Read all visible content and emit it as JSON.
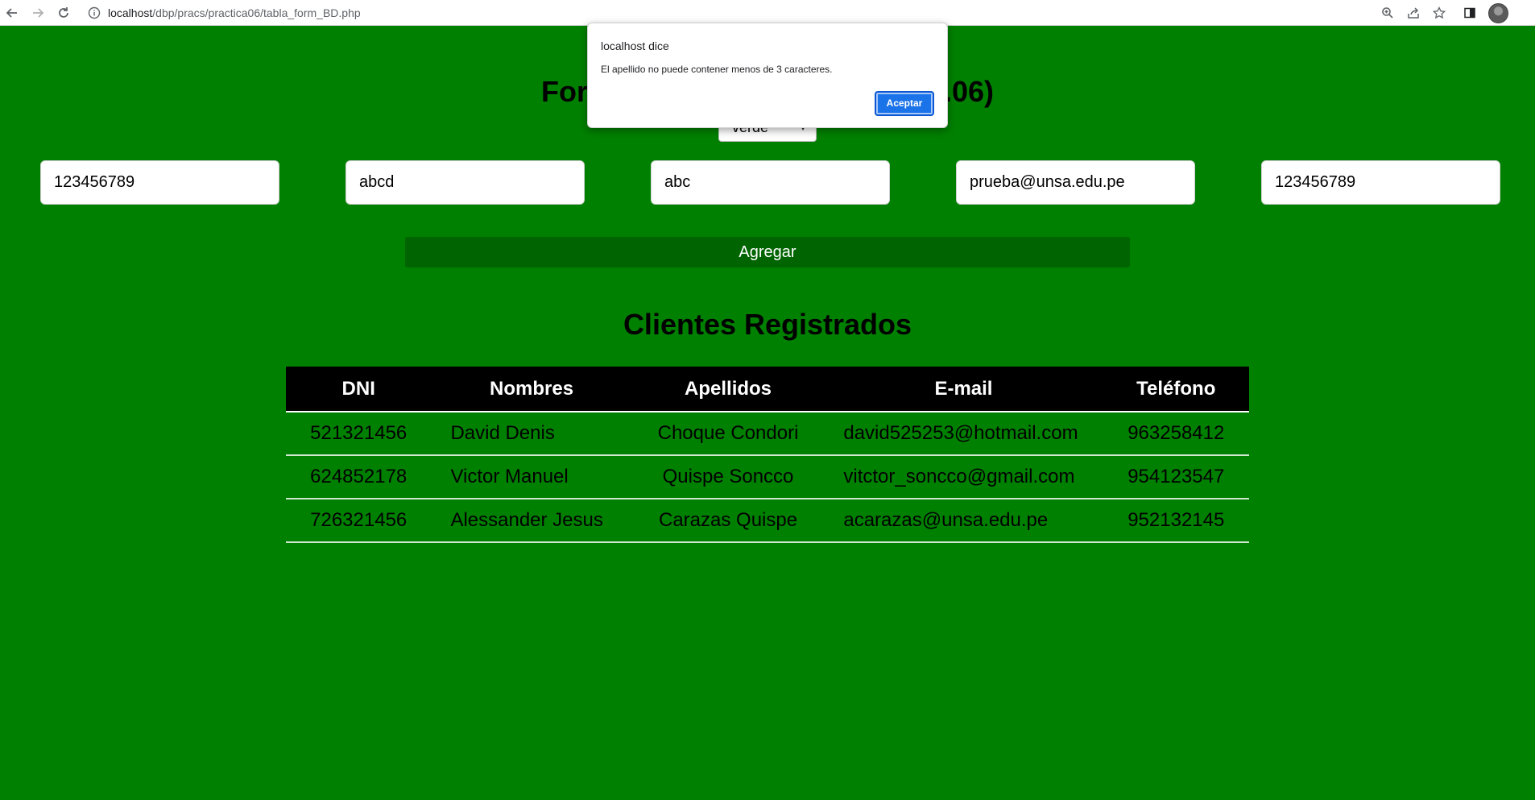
{
  "browser": {
    "url_host": "localhost",
    "url_path": "/dbp/pracs/practica06/tabla_form_BD.php",
    "icons": [
      "back-arrow-icon",
      "forward-arrow-icon",
      "reload-icon",
      "site-info-icon",
      "zoom-icon",
      "share-icon",
      "bookmark-star-icon",
      "side-panel-icon",
      "profile-avatar"
    ]
  },
  "page": {
    "title_left": "Forn",
    "title_right": "a.06)",
    "color_select_value": "verde",
    "fields": [
      "123456789",
      "abcd",
      "abc",
      "prueba@unsa.edu.pe",
      "123456789"
    ],
    "submit_label": "Agregar",
    "section_title": "Clientes Registrados",
    "background_color": "#008000",
    "button_color": "#006400"
  },
  "table": {
    "headers": [
      "DNI",
      "Nombres",
      "Apellidos",
      "E-mail",
      "Teléfono"
    ],
    "rows": [
      [
        "521321456",
        "David Denis",
        "Choque Condori",
        "david525253@hotmail.com",
        "963258412"
      ],
      [
        "624852178",
        "Victor Manuel",
        "Quispe Soncco",
        "vitctor_soncco@gmail.com",
        "954123547"
      ],
      [
        "726321456",
        "Alessander Jesus",
        "Carazas Quispe",
        "acarazas@unsa.edu.pe",
        "952132145"
      ]
    ]
  },
  "dialog": {
    "title": "localhost dice",
    "message": "El apellido no puede contener menos de 3 caracteres.",
    "button_label": "Aceptar",
    "accent_color": "#1a73e8"
  }
}
